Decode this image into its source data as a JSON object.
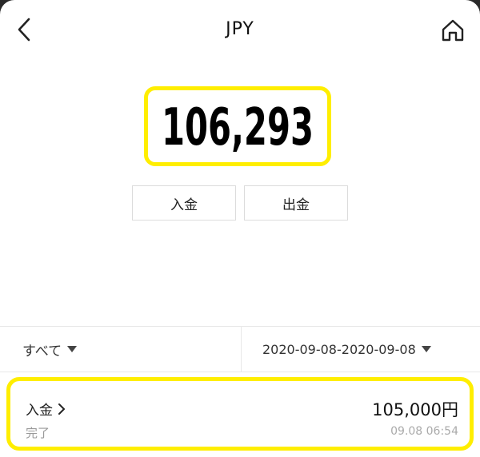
{
  "header": {
    "title": "JPY",
    "back_icon": "chevron-left-icon",
    "home_icon": "home-icon"
  },
  "balance": {
    "value": "106,293"
  },
  "actions": {
    "deposit_label": "入金",
    "withdraw_label": "出金"
  },
  "filter": {
    "type_label": "すべて",
    "date_range": "2020-09-08-2020-09-08"
  },
  "transactions": [
    {
      "type": "入金",
      "status": "完了",
      "amount": "105,000円",
      "time": "09.08 06:54"
    }
  ],
  "colors": {
    "highlight": "#ffee00",
    "text": "#111111",
    "muted": "#999999",
    "border": "#dcdcdc"
  }
}
